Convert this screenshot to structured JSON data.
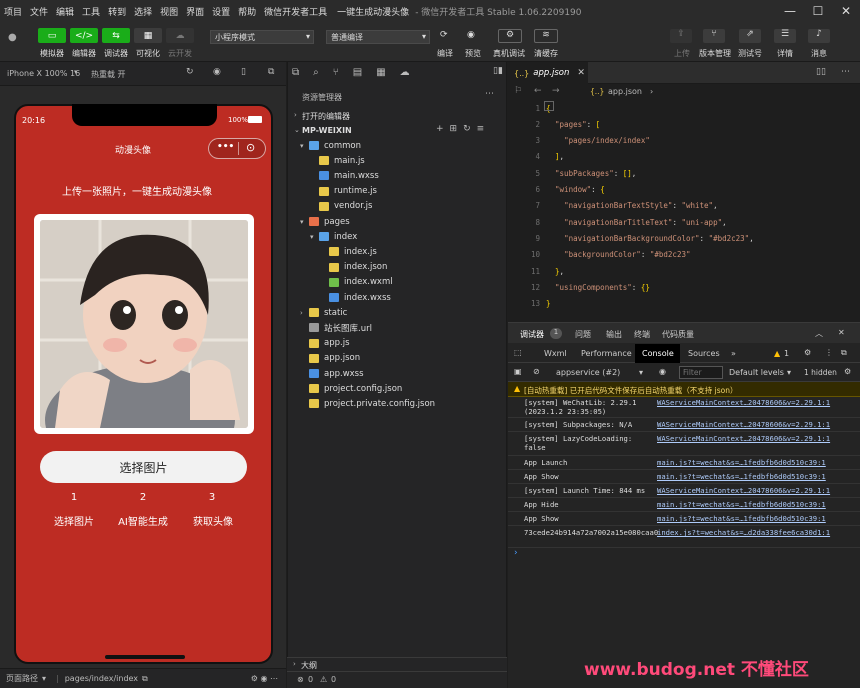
{
  "menubar": {
    "items": [
      "项目",
      "文件",
      "编辑",
      "工具",
      "转到",
      "选择",
      "视图",
      "界面",
      "设置",
      "帮助",
      "微信开发者工具"
    ],
    "title": "一键生成动漫头像",
    "subtitle": "- 微信开发者工具 Stable 1.06.2209190"
  },
  "toolbar": {
    "left_buttons": [
      "模拟器",
      "编辑器",
      "调试器",
      "可视化",
      "云开发"
    ],
    "mode_select": "小程序模式",
    "compile_select": "普通编译",
    "mid_buttons": [
      "编译",
      "预览",
      "真机调试",
      "清缓存"
    ],
    "right_buttons": [
      "上传",
      "版本管理",
      "测试号",
      "详情",
      "消息"
    ]
  },
  "simbar": {
    "device": "iPhone X 100% 16",
    "hotreload": "热重载 开"
  },
  "phone": {
    "time": "20:16",
    "battery": "100%",
    "nav_title": "动漫头像",
    "headline": "上传一张照片，一键生成动漫头像",
    "select_button": "选择图片",
    "steps": [
      {
        "num": "1",
        "label": "选择图片"
      },
      {
        "num": "2",
        "label": "AI智能生成"
      },
      {
        "num": "3",
        "label": "获取头像"
      }
    ]
  },
  "statusbar": {
    "path_label": "页面路径",
    "path": "pages/index/index"
  },
  "explorer": {
    "title": "资源管理器",
    "open_editors": "打开的编辑器",
    "project": "MP-WEIXIN",
    "tree": [
      {
        "name": "common",
        "indent": 1,
        "type": "folder-open",
        "color": "#5aa3e8"
      },
      {
        "name": "main.js",
        "indent": 2,
        "type": "js",
        "color": "#e8c84a"
      },
      {
        "name": "main.wxss",
        "indent": 2,
        "type": "wxss",
        "color": "#4a90e2"
      },
      {
        "name": "runtime.js",
        "indent": 2,
        "type": "js",
        "color": "#e8c84a"
      },
      {
        "name": "vendor.js",
        "indent": 2,
        "type": "js",
        "color": "#e8c84a"
      },
      {
        "name": "pages",
        "indent": 1,
        "type": "folder-open",
        "color": "#e8704a"
      },
      {
        "name": "index",
        "indent": 2,
        "type": "folder-open",
        "color": "#5aa3e8"
      },
      {
        "name": "index.js",
        "indent": 3,
        "type": "js",
        "color": "#e8c84a"
      },
      {
        "name": "index.json",
        "indent": 3,
        "type": "json",
        "color": "#e8c84a"
      },
      {
        "name": "index.wxml",
        "indent": 3,
        "type": "wxml",
        "color": "#6fbf4a"
      },
      {
        "name": "index.wxss",
        "indent": 3,
        "type": "wxss",
        "color": "#4a90e2"
      },
      {
        "name": "static",
        "indent": 1,
        "type": "folder",
        "color": "#e8c84a"
      },
      {
        "name": "站长图库.url",
        "indent": 1,
        "type": "url",
        "color": "#9a9a9a"
      },
      {
        "name": "app.js",
        "indent": 1,
        "type": "js",
        "color": "#e8c84a"
      },
      {
        "name": "app.json",
        "indent": 1,
        "type": "json",
        "color": "#e8c84a"
      },
      {
        "name": "app.wxss",
        "indent": 1,
        "type": "wxss",
        "color": "#4a90e2"
      },
      {
        "name": "project.config.json",
        "indent": 1,
        "type": "json",
        "color": "#e8c84a"
      },
      {
        "name": "project.private.config.json",
        "indent": 1,
        "type": "json",
        "color": "#e8c84a"
      }
    ],
    "outline": "大纲",
    "errors": "0",
    "warnings": "0"
  },
  "editor": {
    "tab": "app.json",
    "breadcrumb": "app.json",
    "lines": [
      {
        "n": "1",
        "t": "{"
      },
      {
        "n": "2",
        "t": "  \"pages\": ["
      },
      {
        "n": "3",
        "t": "    \"pages/index/index\""
      },
      {
        "n": "4",
        "t": "  ],"
      },
      {
        "n": "5",
        "t": "  \"subPackages\": [],"
      },
      {
        "n": "6",
        "t": "  \"window\": {"
      },
      {
        "n": "7",
        "t": "    \"navigationBarTextStyle\": \"white\","
      },
      {
        "n": "8",
        "t": "    \"navigationBarTitleText\": \"uni-app\","
      },
      {
        "n": "9",
        "t": "    \"navigationBarBackgroundColor\": \"#bd2c23\","
      },
      {
        "n": "10",
        "t": "    \"backgroundColor\": \"#bd2c23\""
      },
      {
        "n": "11",
        "t": "  },"
      },
      {
        "n": "12",
        "t": "  \"usingComponents\": {}"
      },
      {
        "n": "13",
        "t": "}"
      }
    ]
  },
  "devtools": {
    "top_tabs": [
      "调试器",
      "1",
      "问题",
      "输出",
      "终端",
      "代码质量"
    ],
    "tabs": [
      "Wxml",
      "Performance",
      "Console",
      "Sources",
      "»"
    ],
    "warn_count": "1",
    "context": "appservice (#2)",
    "filter_placeholder": "Filter",
    "levels": "Default levels",
    "hidden": "1 hidden",
    "warning_msg": "[自动热重载] 已开启代码文件保存后自动热重载（不支持 json）",
    "logs": [
      {
        "msg": "[system] WeChatLib: 2.29.1 (2023.1.2 23:35:05)",
        "src": "WAServiceMainContext…20478606&v=2.29.1:1"
      },
      {
        "msg": "[system] Subpackages: N/A",
        "src": "WAServiceMainContext…20478606&v=2.29.1:1"
      },
      {
        "msg": "[system] LazyCodeLoading: false",
        "src": "WAServiceMainContext…20478606&v=2.29.1:1"
      },
      {
        "msg": "App Launch",
        "src": "main.js?t=wechat&s=…1fedbfb6d0d510c39:1"
      },
      {
        "msg": "App Show",
        "src": "main.js?t=wechat&s=…1fedbfb6d0d510c39:1"
      },
      {
        "msg": "[system] Launch Time: 844 ms",
        "src": "WAServiceMainContext…20478606&v=2.29.1:1"
      },
      {
        "msg": "App Hide",
        "src": "main.js?t=wechat&s=…1fedbfb6d0d510c39:1"
      },
      {
        "msg": "App Show",
        "src": "main.js?t=wechat&s=…1fedbfb6d0d510c39:1"
      },
      {
        "msg": "73cede24b914a72a7002a15e080caa0",
        "src": "index.js?t=wechat&s=…d2da338fee6ca30d1:1"
      }
    ]
  },
  "watermark": "www.budog.net 不懂社区"
}
